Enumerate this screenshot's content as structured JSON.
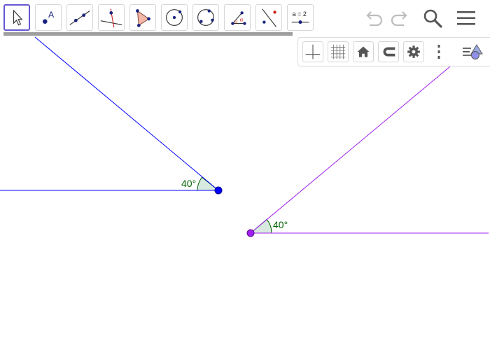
{
  "toolbar": {
    "tools": [
      {
        "name": "move-tool",
        "selected": true
      },
      {
        "name": "point-tool",
        "label": "A"
      },
      {
        "name": "line-tool"
      },
      {
        "name": "perpendicular-line-tool"
      },
      {
        "name": "polygon-tool"
      },
      {
        "name": "circle-center-point-tool"
      },
      {
        "name": "circle-three-points-tool"
      },
      {
        "name": "angle-tool",
        "label": "α"
      },
      {
        "name": "reflect-tool"
      },
      {
        "name": "slider-tool",
        "label": "a = 2"
      }
    ],
    "actions": [
      "undo-icon",
      "redo-icon",
      "search-icon",
      "menu-icon"
    ]
  },
  "stylebar": {
    "buttons": [
      "axes-icon",
      "grid-icon",
      "home-icon",
      "magnet-icon",
      "gear-icon",
      "more-icon",
      "view-toggle-icon"
    ]
  },
  "graphics": {
    "angles": [
      {
        "label": "40°",
        "color": "#006400"
      },
      {
        "label": "40°",
        "color": "#006400"
      }
    ],
    "colors": {
      "blue": "#0000ff",
      "purple": "#a020f0",
      "angle_fill": "#d8eadf"
    }
  }
}
